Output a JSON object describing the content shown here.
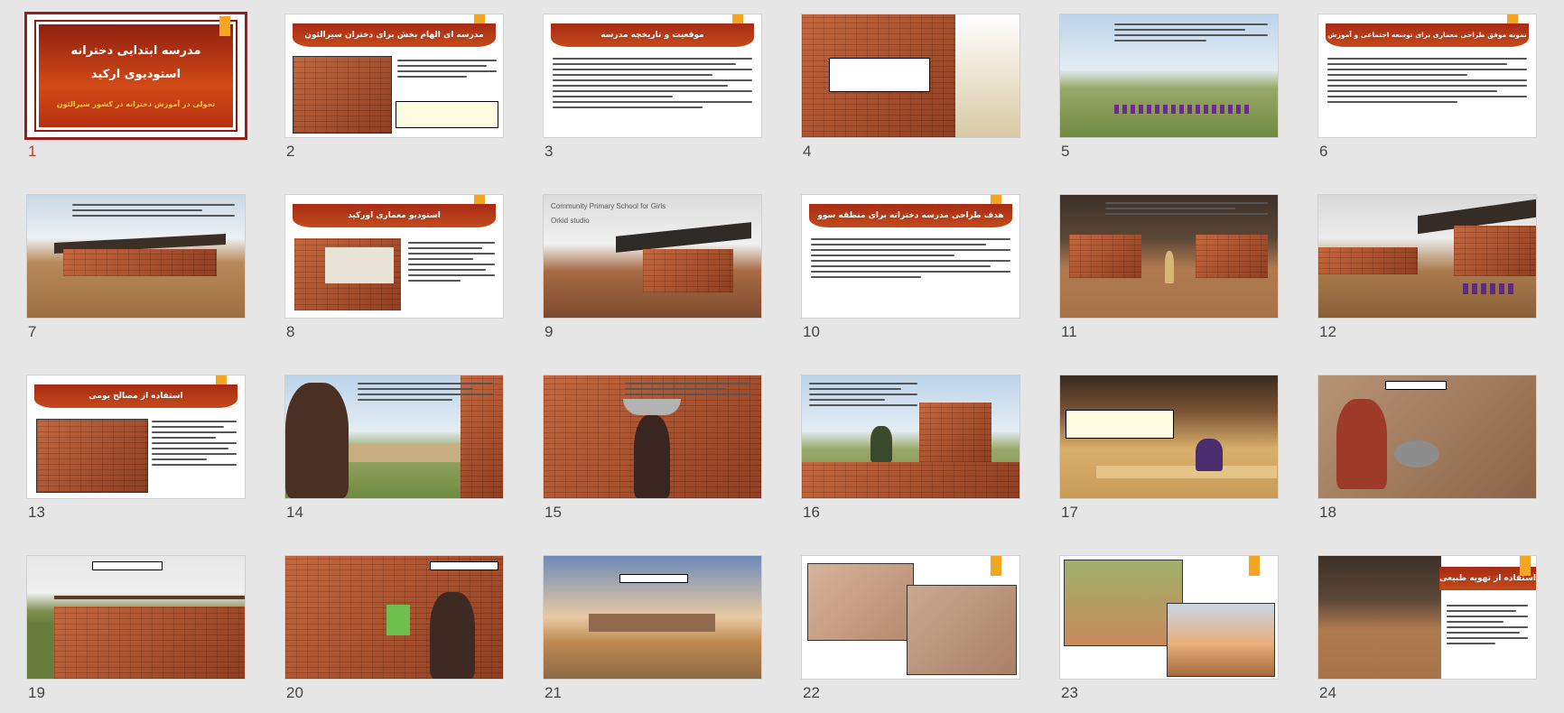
{
  "slides": [
    {
      "number": "1",
      "selected": true,
      "title_line1": "مدرسه ابتدایی دخترانه",
      "title_line2": "استودیوی ارکید",
      "subtitle": "تحولی در آموزش دخترانه در کشور سیرالئون"
    },
    {
      "number": "2",
      "title": "مدرسه ای الهام بخش برای دختران سیرالئون"
    },
    {
      "number": "3",
      "title": "موقعیت و تاریخچه مدرسه"
    },
    {
      "number": "4"
    },
    {
      "number": "5"
    },
    {
      "number": "6",
      "title": "نمونه موفق طراحی معماری برای توسعه اجتماعی و آموزش"
    },
    {
      "number": "7"
    },
    {
      "number": "8",
      "title": "استودیو معماری اورکید"
    },
    {
      "number": "9",
      "en_line1": "Community Primary School for Girls",
      "en_line2": "Orkid studio"
    },
    {
      "number": "10",
      "title": "هدف طراحی مدرسه دخترانه برای منطقه سوو"
    },
    {
      "number": "11"
    },
    {
      "number": "12"
    },
    {
      "number": "13",
      "title": "استفاده از مصالح بومی"
    },
    {
      "number": "14"
    },
    {
      "number": "15"
    },
    {
      "number": "16"
    },
    {
      "number": "17"
    },
    {
      "number": "18"
    },
    {
      "number": "19"
    },
    {
      "number": "20"
    },
    {
      "number": "21"
    },
    {
      "number": "22"
    },
    {
      "number": "23"
    },
    {
      "number": "24",
      "title": "استفاده از تهویه طبیعی"
    }
  ],
  "colors": {
    "accent": "#c0392b",
    "title_bar": "#b3361a",
    "tag": "#f4a521"
  }
}
